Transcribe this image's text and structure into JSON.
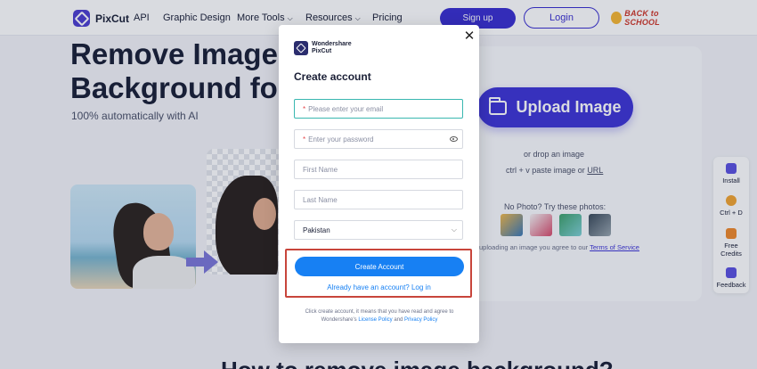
{
  "nav": {
    "logo_text": "PixCut",
    "links": [
      "API",
      "Graphic Design",
      "More Tools",
      "Resources",
      "Pricing"
    ],
    "signup": "Sign up",
    "login": "Login",
    "promo": "BACK to SCHOOL"
  },
  "hero": {
    "title_line1": "Remove Image",
    "title_line2": "Background for",
    "subtitle": "100% automatically with AI"
  },
  "upload": {
    "button": "Upload Image",
    "drop": "or drop an image",
    "paste_prefix": "ctrl + v paste image or",
    "paste_link": "URL",
    "no_photo": "No Photo? Try these photos:",
    "terms_prefix": "uploading an image you agree to our",
    "terms_link": "Terms of Service"
  },
  "side_tools": [
    {
      "label": "Install",
      "icon": "install-icon",
      "color": "#5b52e0"
    },
    {
      "label": "Ctrl + D",
      "icon": "star-icon",
      "color": "#f2a531"
    },
    {
      "label": "Free Credits",
      "icon": "gift-icon",
      "color": "#f08a2c"
    },
    {
      "label": "Feedback",
      "icon": "feedback-icon",
      "color": "#5b52e0"
    }
  ],
  "bottom_heading": "How to remove image background?",
  "modal": {
    "brand_line1": "Wondershare",
    "brand_line2": "PixCut",
    "title": "Create account",
    "email_placeholder": "Please enter your email",
    "password_placeholder": "Enter your password",
    "first_name_placeholder": "First Name",
    "last_name_placeholder": "Last Name",
    "country_value": "Pakistan",
    "create_button": "Create Account",
    "login_link": "Already have an account? Log in",
    "legal_prefix": "Click create account, it means that you have read and agree to Wondershare's",
    "license_policy": "License Policy",
    "legal_and": "and",
    "privacy_policy": "Privacy Policy"
  },
  "colors": {
    "primary": "#3e35d6",
    "button_blue": "#1780f3",
    "highlight_border": "#c8453b",
    "active_field_border": "#39b7b0"
  }
}
